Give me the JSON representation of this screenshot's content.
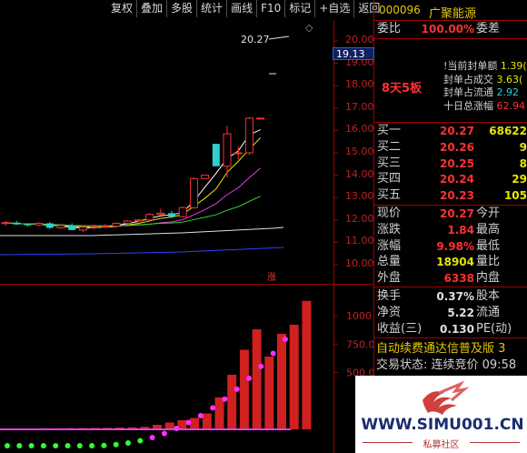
{
  "toolbar": {
    "items": [
      "复权",
      "叠加",
      "多股",
      "统计",
      "画线",
      "F10",
      "标记",
      "+自选",
      "返回"
    ]
  },
  "chart": {
    "price_ticks": [
      "20.00",
      "19.00",
      "18.00",
      "17.00",
      "16.00",
      "15.00",
      "14.00",
      "13.00",
      "12.00",
      "11.00",
      "10.00"
    ],
    "current_price_box": "19.13",
    "high_annotation": "20.27",
    "limit_up_mark": "涨",
    "volume_ticks": [
      "1000",
      "750.0",
      "500.0"
    ],
    "diamond_icon": "◇"
  },
  "chart_data": {
    "type": "candlestick",
    "candles": [
      {
        "o": 11.85,
        "h": 11.95,
        "l": 11.75,
        "c": 11.88
      },
      {
        "o": 11.88,
        "h": 11.95,
        "l": 11.78,
        "c": 11.8
      },
      {
        "o": 11.8,
        "h": 11.85,
        "l": 11.7,
        "c": 11.78
      },
      {
        "o": 11.78,
        "h": 11.9,
        "l": 11.72,
        "c": 11.85
      },
      {
        "o": 11.85,
        "h": 11.9,
        "l": 11.6,
        "c": 11.65
      },
      {
        "o": 11.65,
        "h": 11.8,
        "l": 11.6,
        "c": 11.75
      },
      {
        "o": 11.75,
        "h": 11.85,
        "l": 11.55,
        "c": 11.55
      },
      {
        "o": 11.55,
        "h": 11.7,
        "l": 11.45,
        "c": 11.68
      },
      {
        "o": 11.68,
        "h": 11.8,
        "l": 11.6,
        "c": 11.7
      },
      {
        "o": 11.7,
        "h": 11.8,
        "l": 11.65,
        "c": 11.72
      },
      {
        "o": 11.72,
        "h": 11.9,
        "l": 11.68,
        "c": 11.85
      },
      {
        "o": 11.85,
        "h": 12.0,
        "l": 11.8,
        "c": 11.95
      },
      {
        "o": 11.95,
        "h": 12.05,
        "l": 11.9,
        "c": 12.0
      },
      {
        "o": 12.0,
        "h": 12.3,
        "l": 11.95,
        "c": 12.25
      },
      {
        "o": 12.25,
        "h": 12.5,
        "l": 12.2,
        "c": 12.3
      },
      {
        "o": 12.3,
        "h": 12.4,
        "l": 12.1,
        "c": 12.15
      },
      {
        "o": 12.15,
        "h": 12.6,
        "l": 12.1,
        "c": 12.55
      },
      {
        "o": 12.55,
        "h": 13.9,
        "l": 12.5,
        "c": 13.85
      },
      {
        "o": 13.85,
        "h": 14.0,
        "l": 13.85,
        "c": 14.0
      },
      {
        "o": 15.4,
        "h": 15.4,
        "l": 14.4,
        "c": 14.4
      },
      {
        "o": 14.4,
        "h": 16.2,
        "l": 13.9,
        "c": 15.85
      },
      {
        "o": 15.0,
        "h": 15.3,
        "l": 14.7,
        "c": 15.0
      },
      {
        "o": 15.0,
        "h": 16.6,
        "l": 14.9,
        "c": 16.55
      },
      {
        "o": 16.55,
        "h": 16.55,
        "l": 16.55,
        "c": 16.55
      }
    ],
    "volumes": [
      8,
      9,
      10,
      11,
      12,
      13,
      14,
      16,
      18,
      22,
      40,
      60,
      80,
      100,
      140,
      280,
      480,
      700,
      880,
      640,
      840,
      920,
      1130
    ]
  },
  "panel": {
    "code": "000096",
    "name": "广聚能源",
    "weibi_label": "委比",
    "weibi_val": "100.00%",
    "weicha_label": "委差",
    "badge": "8天5板",
    "seal": [
      {
        "label": "!当前封单额",
        "val": "1.39("
      },
      {
        "label": "封单占成交",
        "val": "3.63("
      },
      {
        "label": "封单占流通",
        "val": "2.92"
      },
      {
        "label": "十日总涨幅",
        "val": "62.94"
      }
    ],
    "asks": [
      {
        "label": "卖五",
        "price": "",
        "qty": ""
      },
      {
        "label": "卖四",
        "price": "",
        "qty": ""
      },
      {
        "label": "卖三",
        "price": "",
        "qty": ""
      },
      {
        "label": "卖二",
        "price": "",
        "qty": ""
      },
      {
        "label": "卖一",
        "price": "",
        "qty": ""
      }
    ],
    "bids": [
      {
        "label": "买一",
        "price": "20.27",
        "qty": "68622"
      },
      {
        "label": "买二",
        "price": "20.26",
        "qty": "9"
      },
      {
        "label": "买三",
        "price": "20.25",
        "qty": "8"
      },
      {
        "label": "买四",
        "price": "20.24",
        "qty": "29"
      },
      {
        "label": "买五",
        "price": "20.23",
        "qty": "105"
      }
    ],
    "stats": [
      {
        "l1": "现价",
        "v1": "20.27",
        "l2": "今开",
        "v2": ""
      },
      {
        "l1": "涨跌",
        "v1": "1.84",
        "l2": "最高",
        "v2": ""
      },
      {
        "l1": "涨幅",
        "v1": "9.98%",
        "l2": "最低",
        "v2": ""
      },
      {
        "l1": "总量",
        "v1": "18904",
        "l2": "量比",
        "v2": ""
      },
      {
        "l1": "外盘",
        "v1": "6338",
        "l2": "内盘",
        "v2": ""
      }
    ],
    "stats2": [
      {
        "l1": "换手",
        "v1": "0.37%",
        "l2": "股本",
        "v2": ""
      },
      {
        "l1": "净资",
        "v1": "5.22",
        "l2": "流通",
        "v2": ""
      },
      {
        "l1": "收益(三)",
        "v1": "0.130",
        "l2": "PE(动)",
        "v2": ""
      }
    ],
    "banner": "自动续费通达信普及版 3",
    "trade_status": "交易状态: 连续竞价 09:58"
  },
  "watermark": {
    "site": "WWW.SIMU001.CN",
    "sub": "私募社区"
  }
}
